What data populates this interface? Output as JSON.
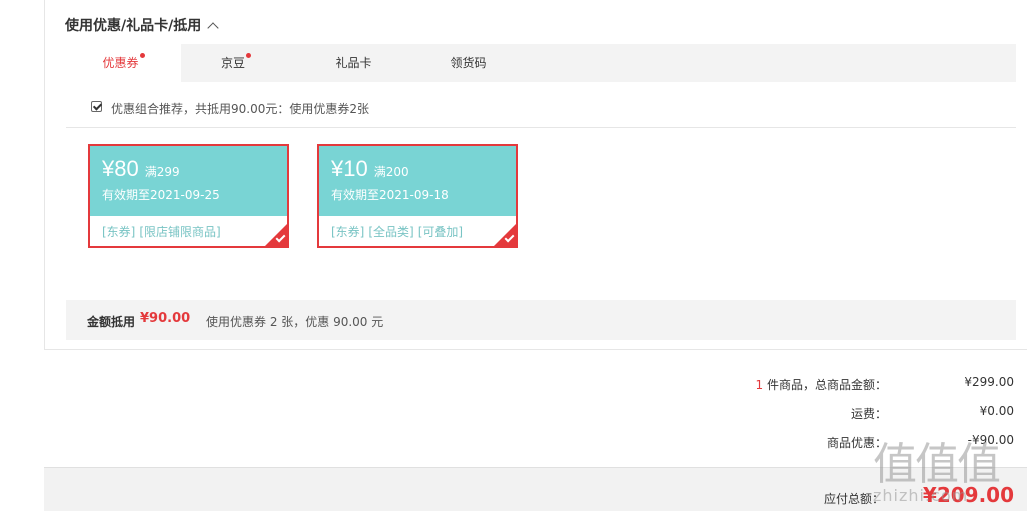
{
  "section": {
    "title": "使用优惠/礼品卡/抵用"
  },
  "tabs": [
    {
      "label": "优惠券",
      "active": true,
      "has_dot": true
    },
    {
      "label": "京豆",
      "active": false,
      "has_dot": true
    },
    {
      "label": "礼品卡",
      "active": false,
      "has_dot": false
    },
    {
      "label": "领货码",
      "active": false,
      "has_dot": false
    }
  ],
  "recommend": {
    "checked": true,
    "text": "优惠组合推荐，共抵用90.00元：使用优惠券2张"
  },
  "coupons": [
    {
      "amount": "¥80",
      "condition": "满299",
      "expire": "有效期至2021-09-25",
      "tags": [
        "[东券]",
        "[限店铺限商品]"
      ],
      "selected": true
    },
    {
      "amount": "¥10",
      "condition": "满200",
      "expire": "有效期至2021-09-18",
      "tags": [
        "[东券]",
        "[全品类]",
        "[可叠加]"
      ],
      "selected": true
    }
  ],
  "summary": {
    "label": "金额抵用",
    "amount": "¥90.00",
    "detail": "使用优惠券 2 张，优惠 90.00 元"
  },
  "totals": {
    "items_count": "1",
    "items_label": " 件商品，总商品金额：",
    "items_value": "¥299.00",
    "shipping_label": "运费：",
    "shipping_value": "¥0.00",
    "discount_label": "商品优惠：",
    "discount_value": "-¥90.00"
  },
  "payable": {
    "label": "应付总额：",
    "value": "¥209.00"
  },
  "watermark": {
    "logo": "值值值",
    "text": "zhizhi.com"
  },
  "colors": {
    "accent": "#e4393c",
    "coupon_bg": "#79d4d4",
    "tag": "#79c4c4"
  }
}
